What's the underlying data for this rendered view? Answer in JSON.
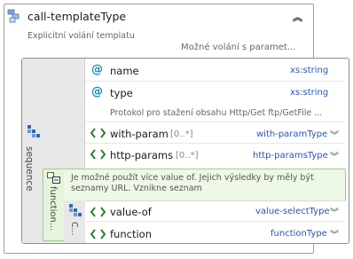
{
  "type_box": {
    "title": "call-templateType",
    "collapse_glyph": "︽",
    "documentation": "Explicitní volání templatu",
    "note": "Možné volání s paramet..."
  },
  "sequence": {
    "label": "sequence",
    "rows": [
      {
        "icon": "attribute-icon",
        "name": "name",
        "occurs": "",
        "type": "xs:string",
        "expand": ""
      },
      {
        "icon": "attribute-icon",
        "name": "type",
        "occurs": "",
        "type": "xs:string",
        "expand": ""
      },
      {
        "icon": "element-icon",
        "name": "with-param",
        "occurs": "[0..*]",
        "type": "with-paramType",
        "expand": "︾"
      },
      {
        "icon": "element-icon",
        "name": "http-params",
        "occurs": "[0..*]",
        "type": "http-paramsType",
        "expand": "︾"
      }
    ],
    "type_doc": "Protokol pro stažení obsahu Http/Get ftp/GetFile ..."
  },
  "choice": {
    "label": "function...",
    "doc_line1": "Je možné použít více value of. Jejich výsledky by měly být",
    "doc_line2": "seznamy URL. Vznikne seznam",
    "compositor_label": "C...",
    "rows": [
      {
        "name": "value-of",
        "occurs": "",
        "type": "value-selectType",
        "expand": "︾"
      },
      {
        "name": "function",
        "occurs": "",
        "type": "functionType",
        "expand": "︾"
      }
    ]
  },
  "colors": {
    "attribute": "#0d8fb8",
    "element": "#2e7d32",
    "type_ref": "#2a55b0",
    "choice_bg": "#eef8e6"
  }
}
